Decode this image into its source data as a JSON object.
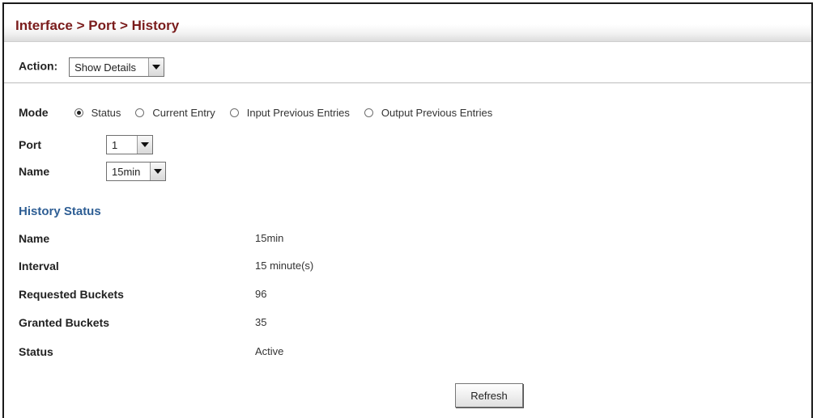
{
  "header": {
    "title": "Interface > Port > History"
  },
  "action": {
    "label": "Action:",
    "selected": "Show Details"
  },
  "form": {
    "mode_label": "Mode",
    "mode_options": [
      {
        "label": "Status",
        "selected": true
      },
      {
        "label": "Current Entry",
        "selected": false
      },
      {
        "label": "Input Previous Entries",
        "selected": false
      },
      {
        "label": "Output Previous Entries",
        "selected": false
      }
    ],
    "port_label": "Port",
    "port_value": "1",
    "name_label": "Name",
    "name_value": "15min"
  },
  "history_status": {
    "heading": "History Status",
    "rows": [
      {
        "key": "Name",
        "value": "15min"
      },
      {
        "key": "Interval",
        "value": "15 minute(s)"
      },
      {
        "key": "Requested Buckets",
        "value": "96"
      },
      {
        "key": "Granted Buckets",
        "value": "35"
      },
      {
        "key": "Status",
        "value": "Active"
      }
    ]
  },
  "buttons": {
    "refresh": "Refresh"
  }
}
